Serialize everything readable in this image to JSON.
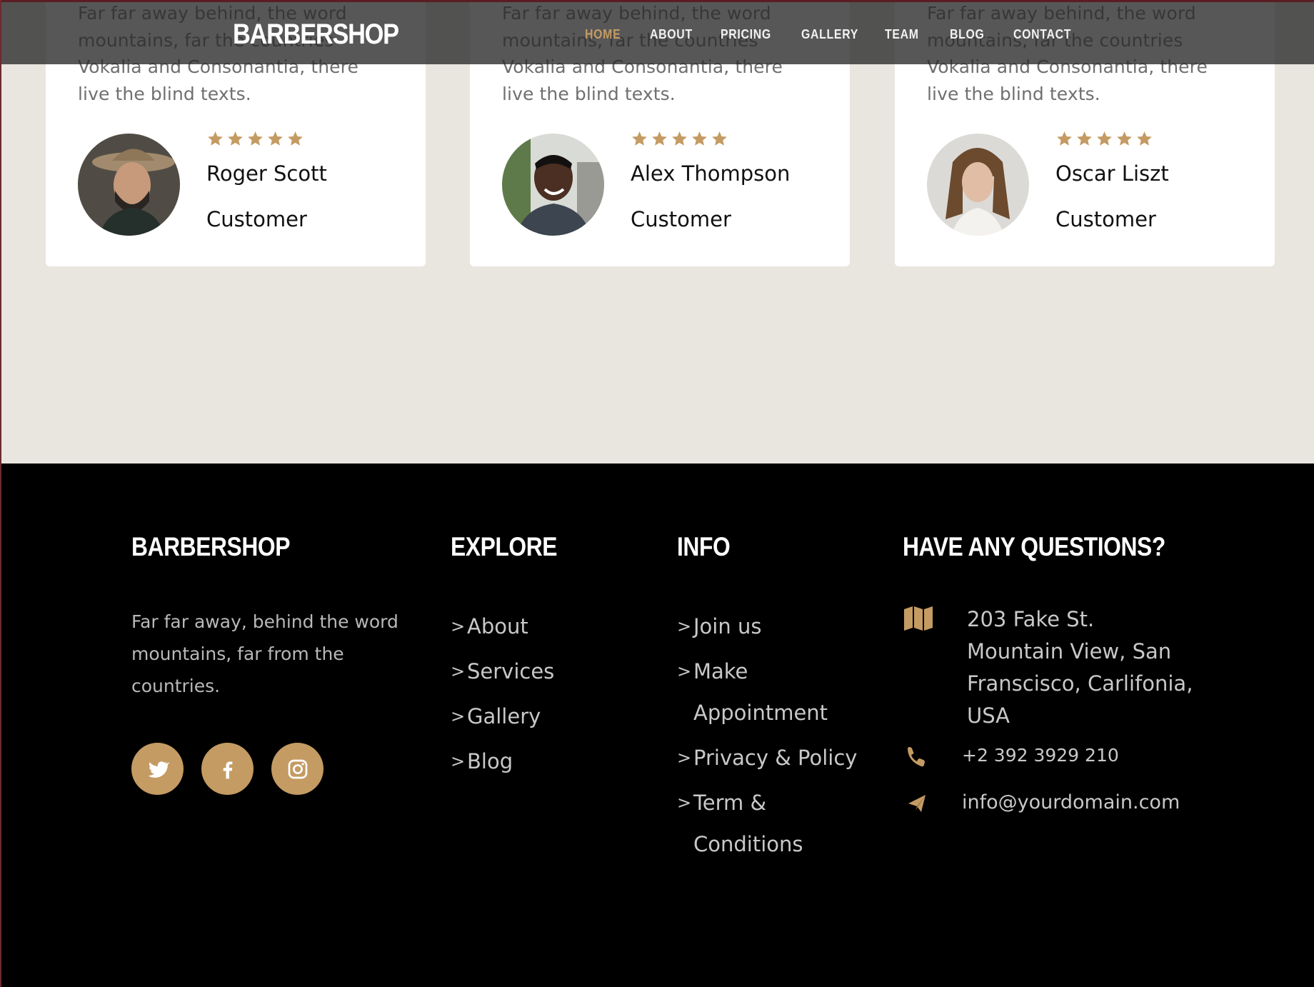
{
  "navbar": {
    "logo": "BARBERSHOP",
    "items": [
      {
        "label": "HOME",
        "active": true
      },
      {
        "label": "ABOUT",
        "active": false
      },
      {
        "label": "PRICING",
        "active": false
      },
      {
        "label": "GALLERY",
        "active": false
      },
      {
        "label": "TEAM",
        "active": false
      },
      {
        "label": "BLOG",
        "active": false
      },
      {
        "label": "CONTACT",
        "active": false
      }
    ]
  },
  "testimonials": [
    {
      "text": "Far far away behind, the word mountains, far the countries Vokalia and Consonantia, there live the blind texts.",
      "name": "Roger Scott",
      "role": "Customer",
      "rating": 5
    },
    {
      "text": "Far far away behind, the word mountains, far the countries Vokalia and Consonantia, there live the blind texts.",
      "name": "Alex Thompson",
      "role": "Customer",
      "rating": 5
    },
    {
      "text": "Far far away behind, the word mountains, far the countries Vokalia and Consonantia, there live the blind texts.",
      "name": "Oscar Liszt",
      "role": "Customer",
      "rating": 5
    }
  ],
  "footer": {
    "brand": {
      "heading": "BARBERSHOP",
      "about": "Far far away, behind the word mountains, far from the countries.",
      "social": [
        "twitter-icon",
        "facebook-icon",
        "instagram-icon"
      ]
    },
    "explore": {
      "heading": "EXPLORE",
      "links": [
        "About",
        "Services",
        "Gallery",
        "Blog"
      ]
    },
    "info": {
      "heading": "INFO",
      "links": [
        "Join us",
        "Make Appointment",
        "Privacy & Policy",
        "Term & Conditions"
      ]
    },
    "contact": {
      "heading": "HAVE ANY QUESTIONS?",
      "address": "203 Fake St. Mountain View, San Franscisco, Carlifonia, USA",
      "phone": "+2 392 3929 210",
      "email": "info@yourdomain.com"
    }
  },
  "colors": {
    "accent": "#c49b63",
    "section_bg": "#e9e6df",
    "footer_bg": "#000000"
  }
}
